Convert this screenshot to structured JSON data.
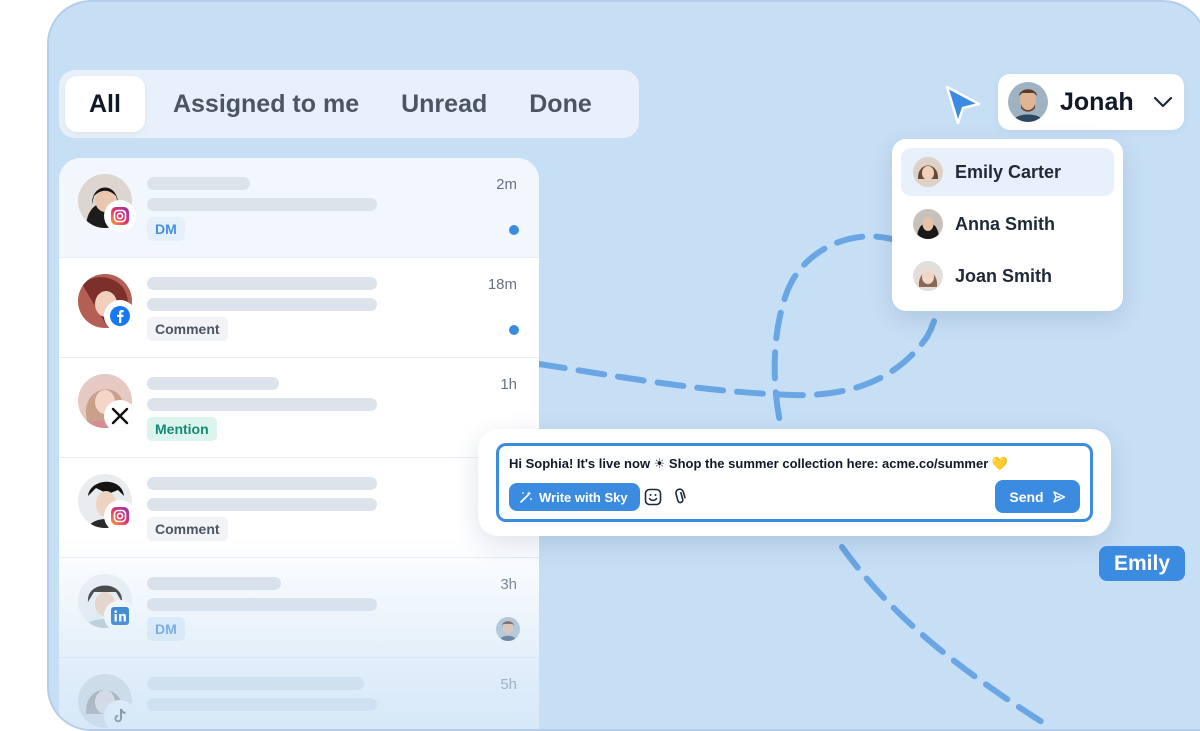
{
  "tabs": [
    {
      "label": "All",
      "active": true
    },
    {
      "label": "Assigned to me",
      "active": false
    },
    {
      "label": "Unread",
      "active": false
    },
    {
      "label": "Done",
      "active": false
    }
  ],
  "conversations": [
    {
      "time": "2m",
      "tag": "DM",
      "tag_style": "dm",
      "platform": "instagram-icon",
      "unread": true
    },
    {
      "time": "18m",
      "tag": "Comment",
      "tag_style": "comment",
      "platform": "facebook-icon",
      "unread": true
    },
    {
      "time": "1h",
      "tag": "Mention",
      "tag_style": "mention",
      "platform": "x-icon",
      "unread": false
    },
    {
      "time": "",
      "tag": "Comment",
      "tag_style": "comment",
      "platform": "instagram-icon",
      "unread": false
    },
    {
      "time": "3h",
      "tag": "DM",
      "tag_style": "dm",
      "platform": "linkedin-icon",
      "unread": false,
      "assignee_avatar": true
    },
    {
      "time": "5h",
      "tag": "",
      "tag_style": "",
      "platform": "tiktok-icon",
      "unread": false
    }
  ],
  "user_select": {
    "name": "Jonah"
  },
  "assign_menu": {
    "items": [
      {
        "name": "Emily Carter",
        "hover": true
      },
      {
        "name": "Anna Smith",
        "hover": false
      },
      {
        "name": "Joan Smith",
        "hover": false
      }
    ]
  },
  "composer": {
    "message": "Hi Sophia! It's live now ☀ Shop the summer collection here: acme.co/summer 💛",
    "write_with_sky": "Write with Sky",
    "send": "Send"
  },
  "collaborator_tag": "Emily",
  "colors": {
    "accent": "#3b8be0",
    "canvas": "#c7dff5",
    "dash": "#6aa6e3"
  }
}
